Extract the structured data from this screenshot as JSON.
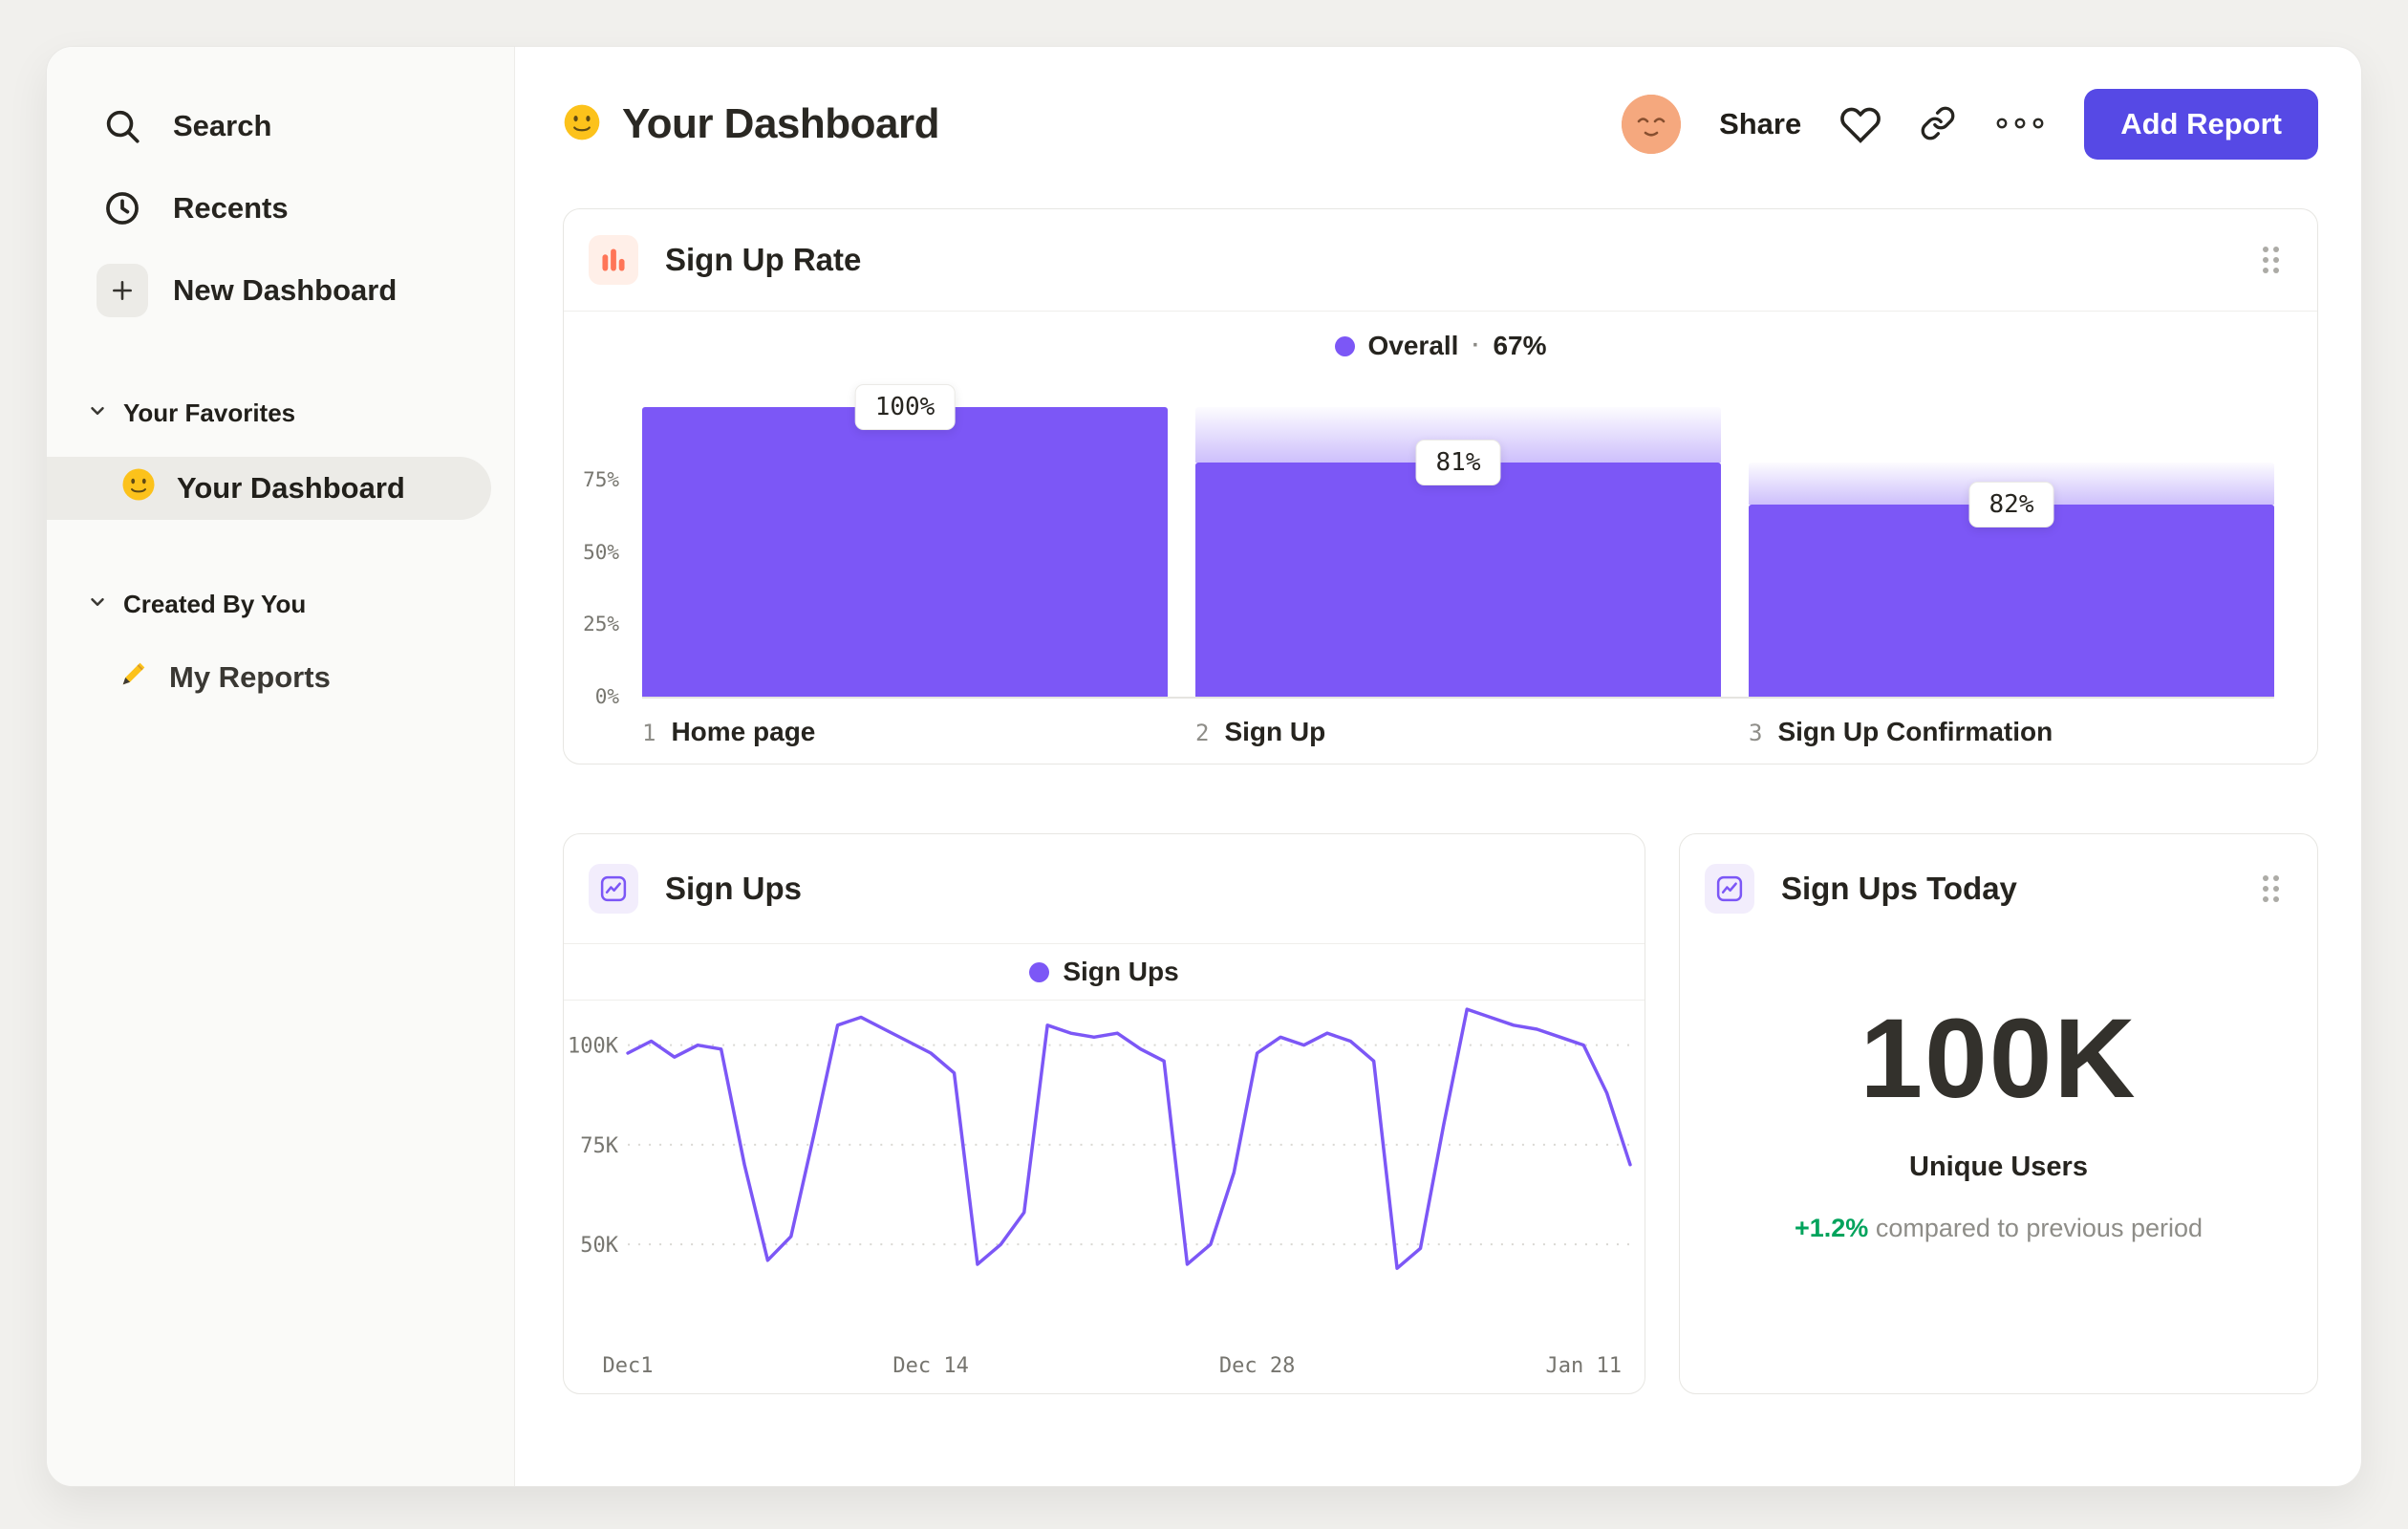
{
  "colors": {
    "accent_purple": "#7C57F6",
    "button_purple": "#5649E5",
    "brand_orange": "#FF7557",
    "positive_green": "#00A35C",
    "page_bg": "#F1F0ED",
    "sidebar_bg": "#FAFAF8"
  },
  "sidebar": {
    "items": [
      {
        "label": "Search"
      },
      {
        "label": "Recents"
      },
      {
        "label": "New Dashboard"
      }
    ],
    "sections": [
      {
        "label": "Your Favorites",
        "items": [
          {
            "label": "Your Dashboard",
            "selected": true
          }
        ]
      },
      {
        "label": "Created By You",
        "items": [
          {
            "label": "My Reports"
          }
        ]
      }
    ]
  },
  "header": {
    "title": "Your Dashboard",
    "share_label": "Share",
    "add_report_label": "Add Report"
  },
  "cards": {
    "sign_up_rate": {
      "title": "Sign Up Rate",
      "legend_label": "Overall",
      "legend_separator": "·",
      "legend_value": "67%"
    },
    "sign_ups": {
      "title": "Sign Ups",
      "legend_label": "Sign Ups"
    },
    "sign_ups_today": {
      "title": "Sign Ups Today",
      "value": "100K",
      "subtitle": "Unique Users",
      "delta": "+1.2%",
      "delta_note": "compared to previous period"
    }
  },
  "chart_data": [
    {
      "type": "bar",
      "variant": "funnel",
      "title": "Sign Up Rate",
      "legend": {
        "label": "Overall",
        "value": "67%"
      },
      "y_ticks": [
        "75%",
        "50%",
        "25%",
        "0%"
      ],
      "ylim": [
        0,
        100
      ],
      "steps": [
        {
          "index": "1",
          "name": "Home page",
          "conversion_label": "100%",
          "height_pct": 100,
          "prev_pct": null
        },
        {
          "index": "2",
          "name": "Sign Up",
          "conversion_label": "81%",
          "height_pct": 81,
          "prev_pct": 100
        },
        {
          "index": "3",
          "name": "Sign Up Confirmation",
          "conversion_label": "82%",
          "height_pct": 66.4,
          "prev_pct": 81
        }
      ]
    },
    {
      "type": "line",
      "title": "Sign Ups",
      "legend": "Sign Ups",
      "unit": "K",
      "ylim": [
        40,
        112
      ],
      "y_ticks": [
        {
          "label": "100K",
          "value": 100
        },
        {
          "label": "75K",
          "value": 75
        },
        {
          "label": "50K",
          "value": 50
        }
      ],
      "x_ticks": [
        {
          "label": "Dec1",
          "index": 0
        },
        {
          "label": "Dec 14",
          "index": 13
        },
        {
          "label": "Dec 28",
          "index": 27
        },
        {
          "label": "Jan 11",
          "index": 41
        }
      ],
      "values": [
        98,
        101,
        97,
        100,
        99,
        70,
        46,
        52,
        78,
        105,
        107,
        104,
        101,
        98,
        93,
        45,
        50,
        58,
        105,
        103,
        102,
        103,
        99,
        96,
        45,
        50,
        68,
        98,
        102,
        100,
        103,
        101,
        96,
        44,
        49,
        80,
        109,
        107,
        105,
        104,
        102,
        100,
        88,
        70
      ]
    }
  ]
}
